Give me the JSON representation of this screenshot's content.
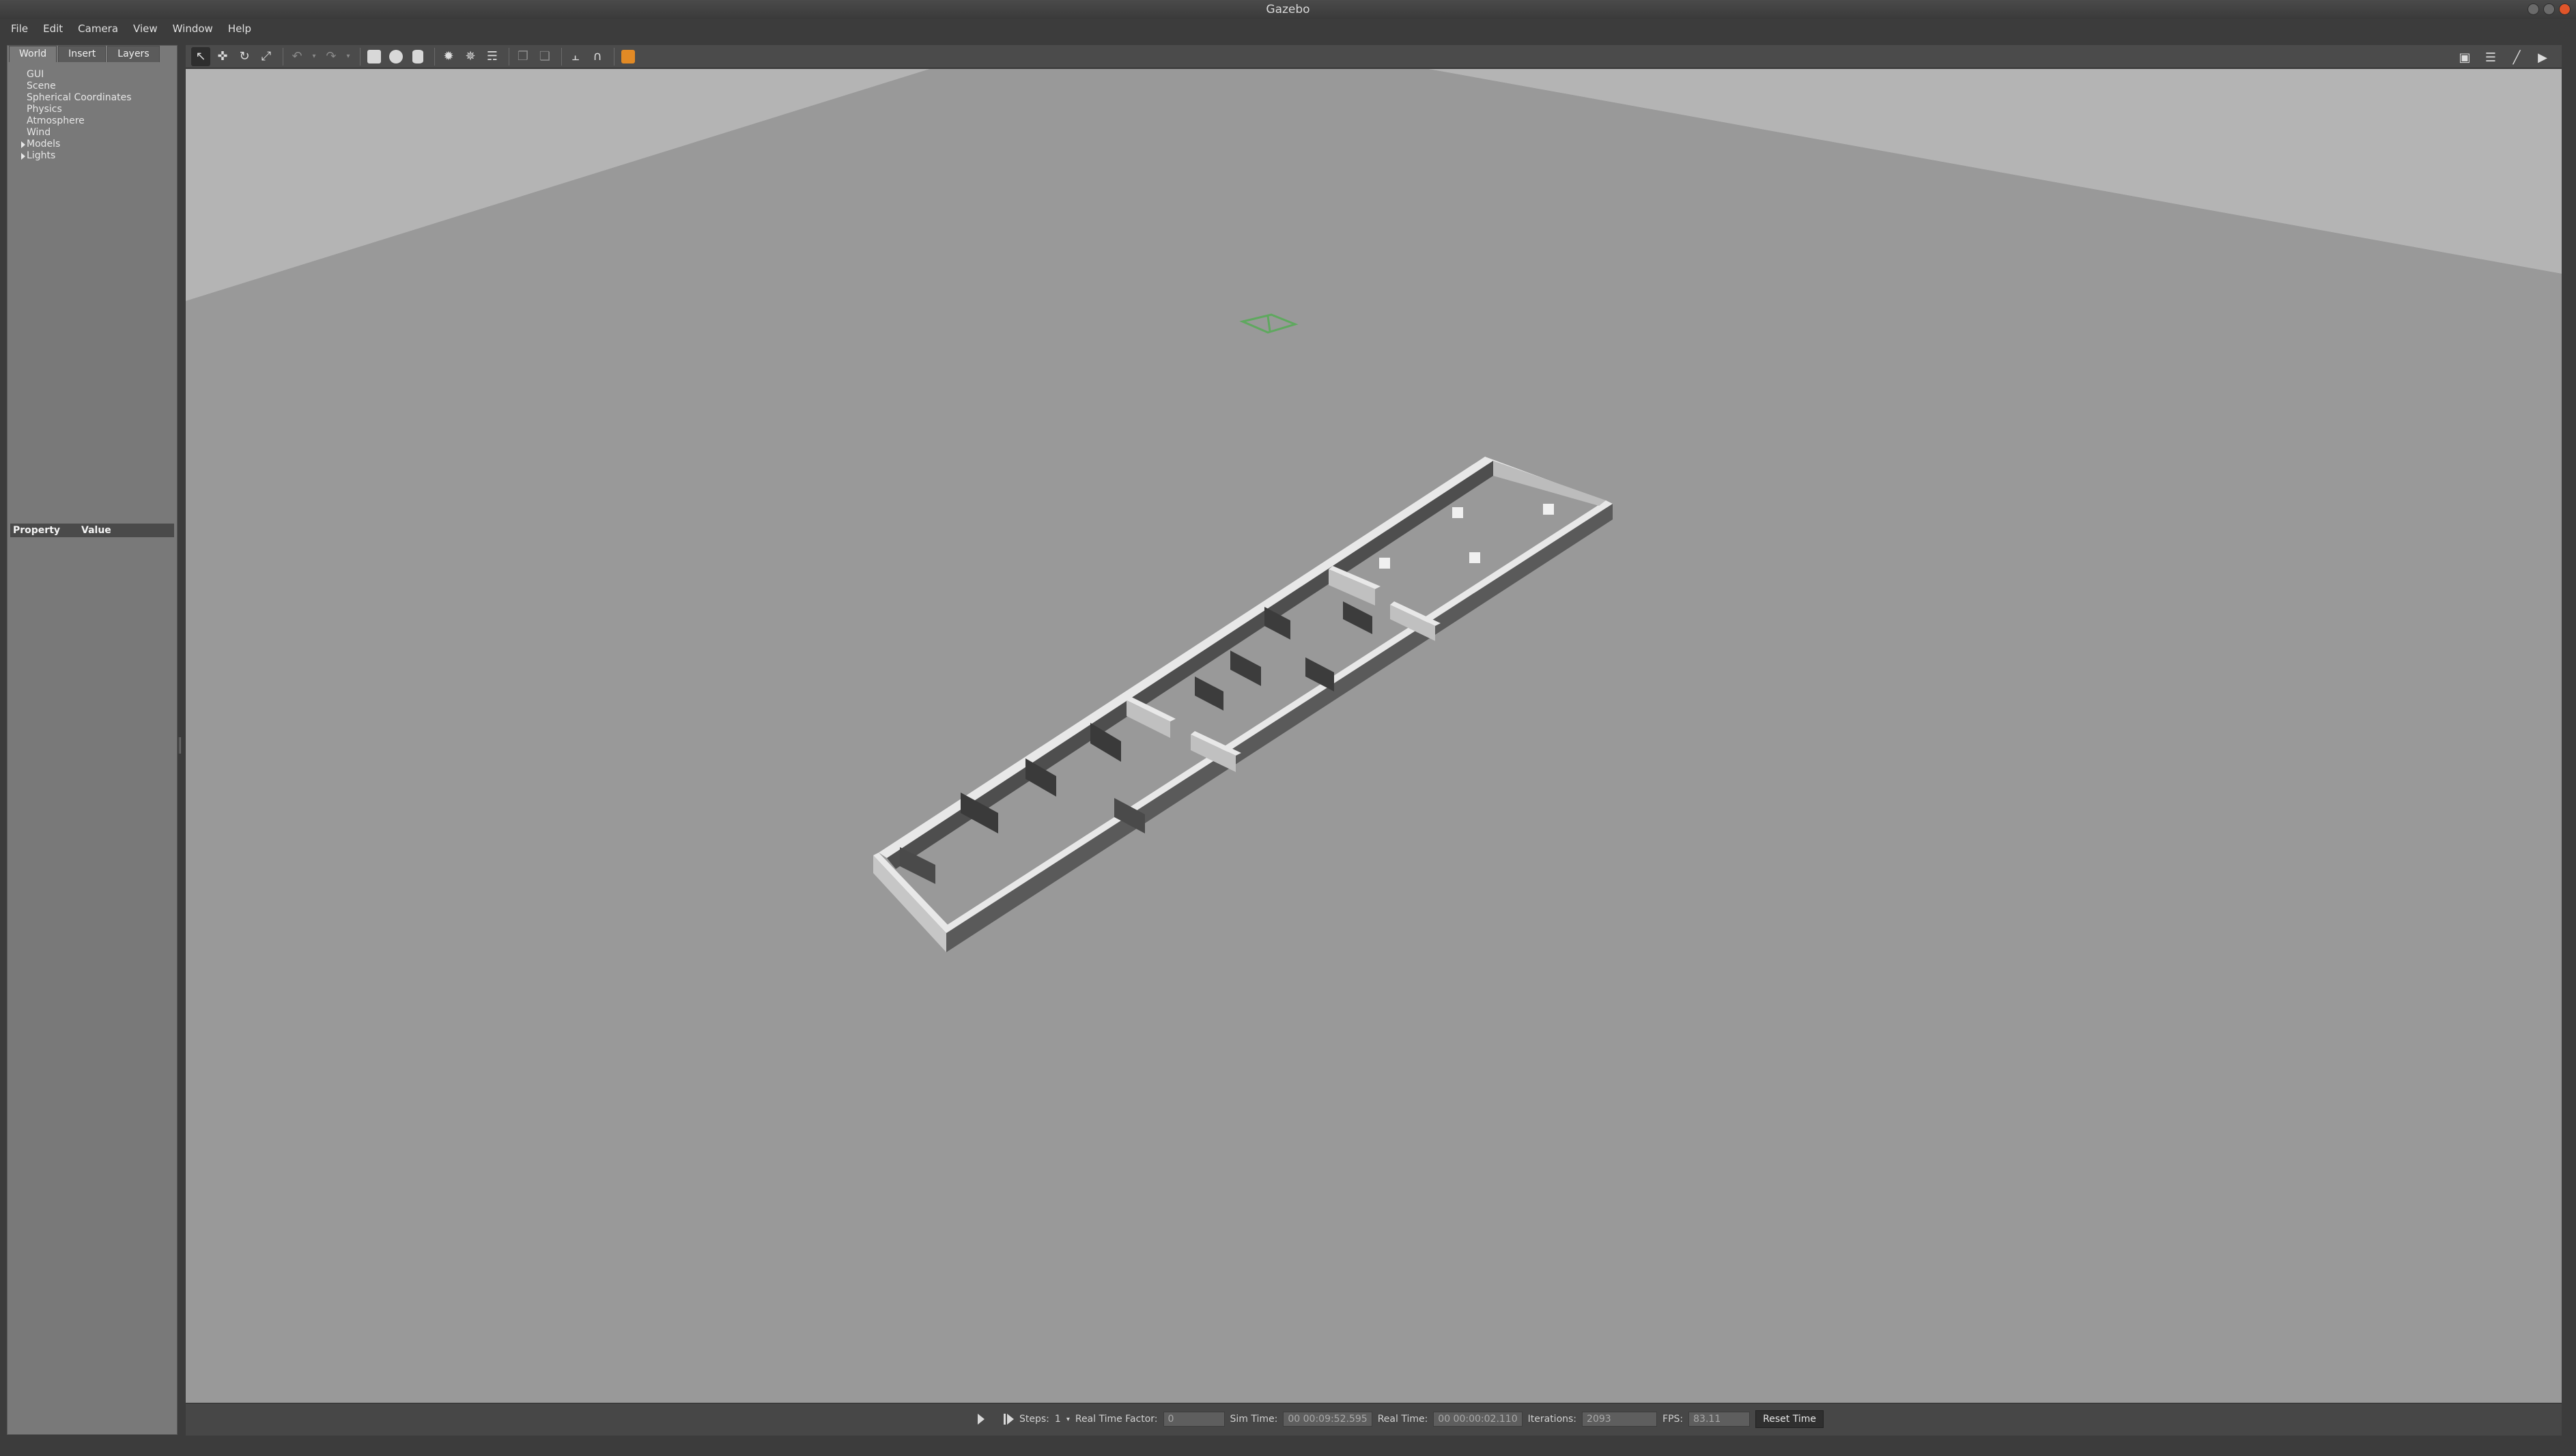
{
  "window": {
    "title": "Gazebo"
  },
  "menubar": [
    "File",
    "Edit",
    "Camera",
    "View",
    "Window",
    "Help"
  ],
  "left_panel": {
    "tabs": [
      "World",
      "Insert",
      "Layers"
    ],
    "active_tab": "World",
    "tree": [
      {
        "label": "GUI",
        "expandable": false
      },
      {
        "label": "Scene",
        "expandable": false
      },
      {
        "label": "Spherical Coordinates",
        "expandable": false
      },
      {
        "label": "Physics",
        "expandable": false
      },
      {
        "label": "Atmosphere",
        "expandable": false
      },
      {
        "label": "Wind",
        "expandable": false
      },
      {
        "label": "Models",
        "expandable": true
      },
      {
        "label": "Lights",
        "expandable": true
      }
    ],
    "property_table": {
      "col1": "Property",
      "col2": "Value"
    }
  },
  "toolbar": {
    "left_tools": [
      "select-mode",
      "translate-mode",
      "rotate-mode",
      "scale-mode",
      "undo",
      "redo",
      "box-shape",
      "sphere-shape",
      "cylinder-shape",
      "point-light",
      "spot-light",
      "directional-light",
      "copy",
      "paste",
      "align",
      "snap",
      "change-view"
    ],
    "right_tools": [
      "screenshot",
      "log",
      "plot",
      "record-video"
    ]
  },
  "statusbar": {
    "steps_label": "Steps:",
    "steps_value": "1",
    "real_time_factor_label": "Real Time Factor:",
    "real_time_factor_value": "0",
    "sim_time_label": "Sim Time:",
    "sim_time_value": "00 00:09:52.595",
    "real_time_label": "Real Time:",
    "real_time_value": "00 00:00:02.110",
    "iterations_label": "Iterations:",
    "iterations_value": "2093",
    "fps_label": "FPS:",
    "fps_value": "83.11",
    "reset_time_label": "Reset Time"
  },
  "colors": {
    "viewport_ground": "#999999",
    "viewport_sky": "#b4b4b4",
    "wall_light": "#e8e8e8",
    "wall_dark": "#5a5a5a",
    "camera_marker": "#5fa85f"
  }
}
